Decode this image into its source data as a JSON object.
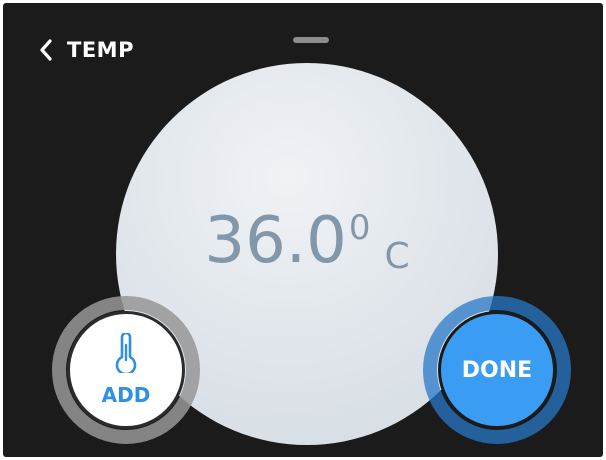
{
  "header": {
    "title": "TEMP",
    "back_icon": "chevron-left-icon"
  },
  "reading": {
    "value": "36.0",
    "degree": "0",
    "unit": "C"
  },
  "buttons": {
    "add_label": "ADD",
    "add_icon": "thermometer-icon",
    "done_label": "DONE"
  },
  "colors": {
    "background": "#1b1b1b",
    "accent": "#3a9cf2",
    "reading_text": "#8397ab"
  }
}
